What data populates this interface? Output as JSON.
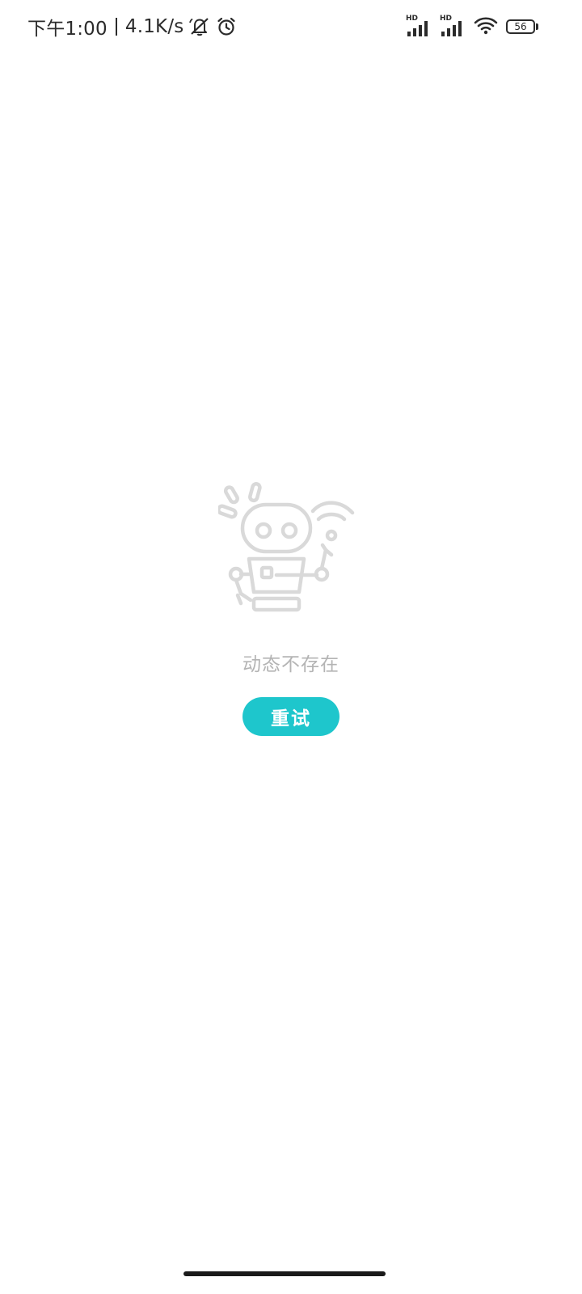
{
  "status_bar": {
    "time": "下午1:00",
    "network_speed": "4.1K/s",
    "signal_1_label": "HD",
    "signal_2_label": "HD",
    "battery_level": "56",
    "icons": [
      "mute-bell-icon",
      "alarm-icon",
      "signal-icon",
      "wifi-icon",
      "battery-icon"
    ]
  },
  "empty_state": {
    "illustration": "robot-icon",
    "message": "动态不存在",
    "retry_label": "重试"
  },
  "colors": {
    "accent": "#1ec6cc",
    "text_primary": "#2b2b2b",
    "text_muted": "#b4b4b4",
    "illustration": "#d9d9d9",
    "background": "#ffffff"
  }
}
